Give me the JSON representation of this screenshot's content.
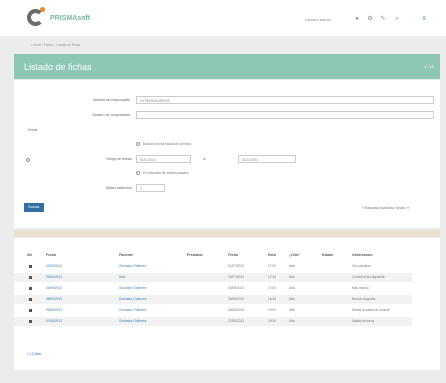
{
  "app": {
    "logo": "PRISMAsoft"
  },
  "header": {
    "user": "Usuario admin",
    "icons": [
      "user-icon",
      "settings-icon",
      "edit-icon",
      "search-icon",
      "menu-icon"
    ]
  },
  "breadcrumb": "» Inicio › Fichas › Listado de fichas",
  "banner": {
    "title": "Listado de fichas",
    "right": "1 / 10"
  },
  "form": {
    "name_label": "Nombre del responsable",
    "name_value": "LUTRASEM MEDRE",
    "number_label": "Número de comprobante",
    "number_value": "",
    "section_label": "Fecha",
    "range_option1": "Buscar a fecha exacta de la fecha",
    "range_label": "Rango de fechas",
    "date_from": "01/01/2013",
    "date_sep": "al",
    "date_to": "31/12/2013",
    "range_option2": "Por intervalo de meses pasados",
    "months_label": "Meses anteriores",
    "months_value": "0",
    "search_button": "Buscar",
    "advanced_link": "» Búsqueda avanzada / ayuda »»"
  },
  "table": {
    "columns": [
      "Sel",
      "Fecha",
      "Paciente",
      "Prestador",
      "Fecha",
      "Hora",
      "¿Cita?",
      "Estado",
      "Observación"
    ],
    "rows": [
      [
        "02/06/2013",
        "Gonzalez Gutierrez",
        "",
        "21/07/2013",
        "17:00",
        "Alta",
        "",
        "Con cambios"
      ],
      [
        "03/06/2013",
        "Ruiz",
        "",
        "23/07/2013",
        "17:30",
        "Alta",
        "",
        "Control al día siguiente"
      ],
      [
        "04/06/2013",
        "Gonzalez Gutierrez",
        "",
        "24/08/2013",
        "17:00",
        "Alta",
        "",
        "Más reposo"
      ],
      [
        "05/06/2013",
        "Gonzalez Gutierrez",
        "",
        "25/08/2013",
        "18:30",
        "Alta",
        "",
        "Nueva ecografía"
      ],
      [
        "06/06/2013",
        "Gonzalez Gutierrez",
        "",
        "26/08/2013",
        "19:00",
        "Alta",
        "",
        "Desde la salida de la tarde"
      ],
      [
        "07/06/2013",
        "Gonzalez Gutierrez",
        "",
        "27/08/2013",
        "19:30",
        "Alta",
        "",
        "Salida nocturna"
      ]
    ]
  },
  "pager": {
    "text": "1 | 2 Más"
  }
}
